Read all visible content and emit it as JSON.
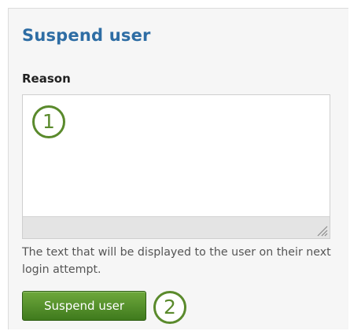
{
  "title": "Suspend user",
  "reason_field": {
    "label": "Reason",
    "value": "",
    "help_text": "The text that will be displayed to the user on their next login attempt."
  },
  "submit_button_label": "Suspend user",
  "callouts": [
    "1",
    "2"
  ],
  "colors": {
    "title": "#2e6da4",
    "button_top": "#6ea83c",
    "button_bottom": "#3f7a1d",
    "callout": "#5a8a2c"
  }
}
